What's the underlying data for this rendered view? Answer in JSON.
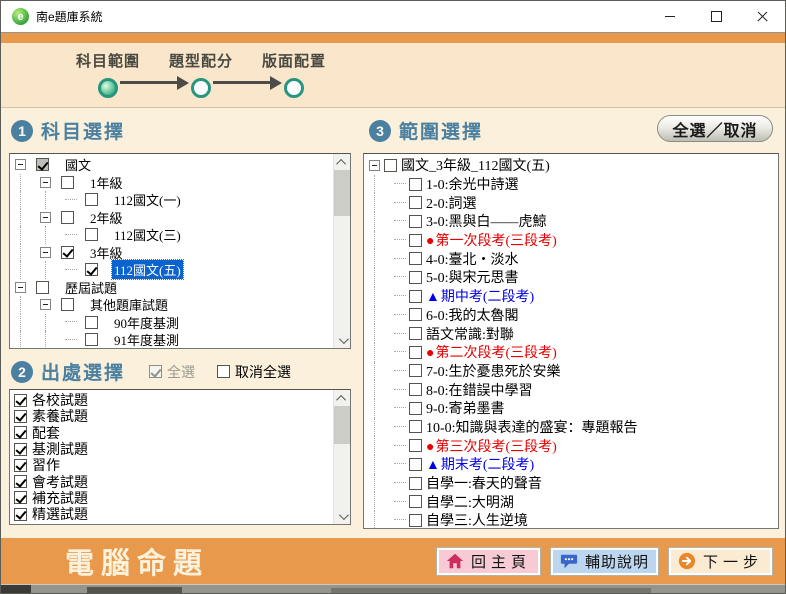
{
  "window": {
    "title": "南e題庫系統"
  },
  "stepper": {
    "steps": [
      {
        "label": "科目範圍",
        "state": "active"
      },
      {
        "label": "題型配分",
        "state": "pending"
      },
      {
        "label": "版面配置",
        "state": "pending"
      }
    ]
  },
  "subject_section": {
    "number": "1",
    "title": "科目選擇",
    "tree": [
      {
        "level": 0,
        "expander": true,
        "check": "partial",
        "label": "國文"
      },
      {
        "level": 1,
        "expander": true,
        "check": "off",
        "label": "1年級"
      },
      {
        "level": 2,
        "expander": false,
        "check": "off",
        "label": "112國文(一)"
      },
      {
        "level": 1,
        "expander": true,
        "check": "off",
        "label": "2年級"
      },
      {
        "level": 2,
        "expander": false,
        "check": "off",
        "label": "112國文(三)"
      },
      {
        "level": 1,
        "expander": true,
        "check": "on",
        "label": "3年級"
      },
      {
        "level": 2,
        "expander": false,
        "check": "on",
        "label": "112國文(五)",
        "selected": true
      },
      {
        "level": 0,
        "expander": true,
        "check": "off",
        "label": "歷屆試題"
      },
      {
        "level": 1,
        "expander": true,
        "check": "off",
        "label": "其他題庫試題"
      },
      {
        "level": 2,
        "expander": false,
        "check": "off",
        "label": "90年度基測"
      },
      {
        "level": 2,
        "expander": false,
        "check": "off",
        "label": "91年度基測"
      }
    ]
  },
  "source_section": {
    "number": "2",
    "title": "出處選擇",
    "select_all": {
      "label": "全選",
      "checked": true,
      "disabled": true
    },
    "deselect_all": {
      "label": "取消全選",
      "checked": false,
      "disabled": false
    },
    "items": [
      "各校試題",
      "素養試題",
      "配套",
      "基測試題",
      "習作",
      "會考試題",
      "補充試題",
      "精選試題"
    ]
  },
  "range_section": {
    "number": "3",
    "title": "範圍選擇",
    "toggle_button_label": "全選／取消",
    "tree": [
      {
        "level": 0,
        "expander": true,
        "check": "off",
        "label": "國文_3年級_112國文(五)"
      },
      {
        "level": 1,
        "expander": false,
        "check": "off",
        "label": "1-0:余光中詩選"
      },
      {
        "level": 1,
        "expander": false,
        "check": "off",
        "label": "2-0:詞選"
      },
      {
        "level": 1,
        "expander": false,
        "check": "off",
        "label": "3-0:黑與白——虎鯨"
      },
      {
        "level": 1,
        "expander": false,
        "check": "off",
        "label": "第一次段考(三段考)",
        "marker": "●",
        "color": "red"
      },
      {
        "level": 1,
        "expander": false,
        "check": "off",
        "label": "4-0:臺北・淡水"
      },
      {
        "level": 1,
        "expander": false,
        "check": "off",
        "label": "5-0:與宋元思書"
      },
      {
        "level": 1,
        "expander": false,
        "check": "off",
        "label": "期中考(二段考)",
        "marker": "▲",
        "color": "blue"
      },
      {
        "level": 1,
        "expander": false,
        "check": "off",
        "label": "6-0:我的太魯閣"
      },
      {
        "level": 1,
        "expander": false,
        "check": "off",
        "label": "語文常識:對聯"
      },
      {
        "level": 1,
        "expander": false,
        "check": "off",
        "label": "第二次段考(三段考)",
        "marker": "●",
        "color": "red"
      },
      {
        "level": 1,
        "expander": false,
        "check": "off",
        "label": "7-0:生於憂患死於安樂"
      },
      {
        "level": 1,
        "expander": false,
        "check": "off",
        "label": "8-0:在錯誤中學習"
      },
      {
        "level": 1,
        "expander": false,
        "check": "off",
        "label": "9-0:寄弟墨書"
      },
      {
        "level": 1,
        "expander": false,
        "check": "off",
        "label": "10-0:知識與表達的盛宴：專題報告"
      },
      {
        "level": 1,
        "expander": false,
        "check": "off",
        "label": "第三次段考(三段考)",
        "marker": "●",
        "color": "red"
      },
      {
        "level": 1,
        "expander": false,
        "check": "off",
        "label": "期末考(二段考)",
        "marker": "▲",
        "color": "blue"
      },
      {
        "level": 1,
        "expander": false,
        "check": "off",
        "label": "自學一:春天的聲音"
      },
      {
        "level": 1,
        "expander": false,
        "check": "off",
        "label": "自學二:大明湖"
      },
      {
        "level": 1,
        "expander": false,
        "check": "off",
        "label": "自學三:人生逆境"
      }
    ]
  },
  "footer": {
    "brand": "電腦命題",
    "buttons": [
      {
        "label": "回主頁",
        "icon": "home-icon"
      },
      {
        "label": "輔助說明",
        "icon": "speech-bubble-icon"
      },
      {
        "label": "下一步",
        "icon": "next-arrow-icon"
      }
    ]
  },
  "colors": {
    "accent_orange": "#E8994B",
    "stepper_bg": "#FAE7CB",
    "main_bg": "#FAF0DB",
    "header_blue": "#4B80A1",
    "stepper_teal": "#27957F",
    "selection_blue": "#0A63CE",
    "exam_red": "#E80000",
    "exam_blue": "#0000E8"
  }
}
